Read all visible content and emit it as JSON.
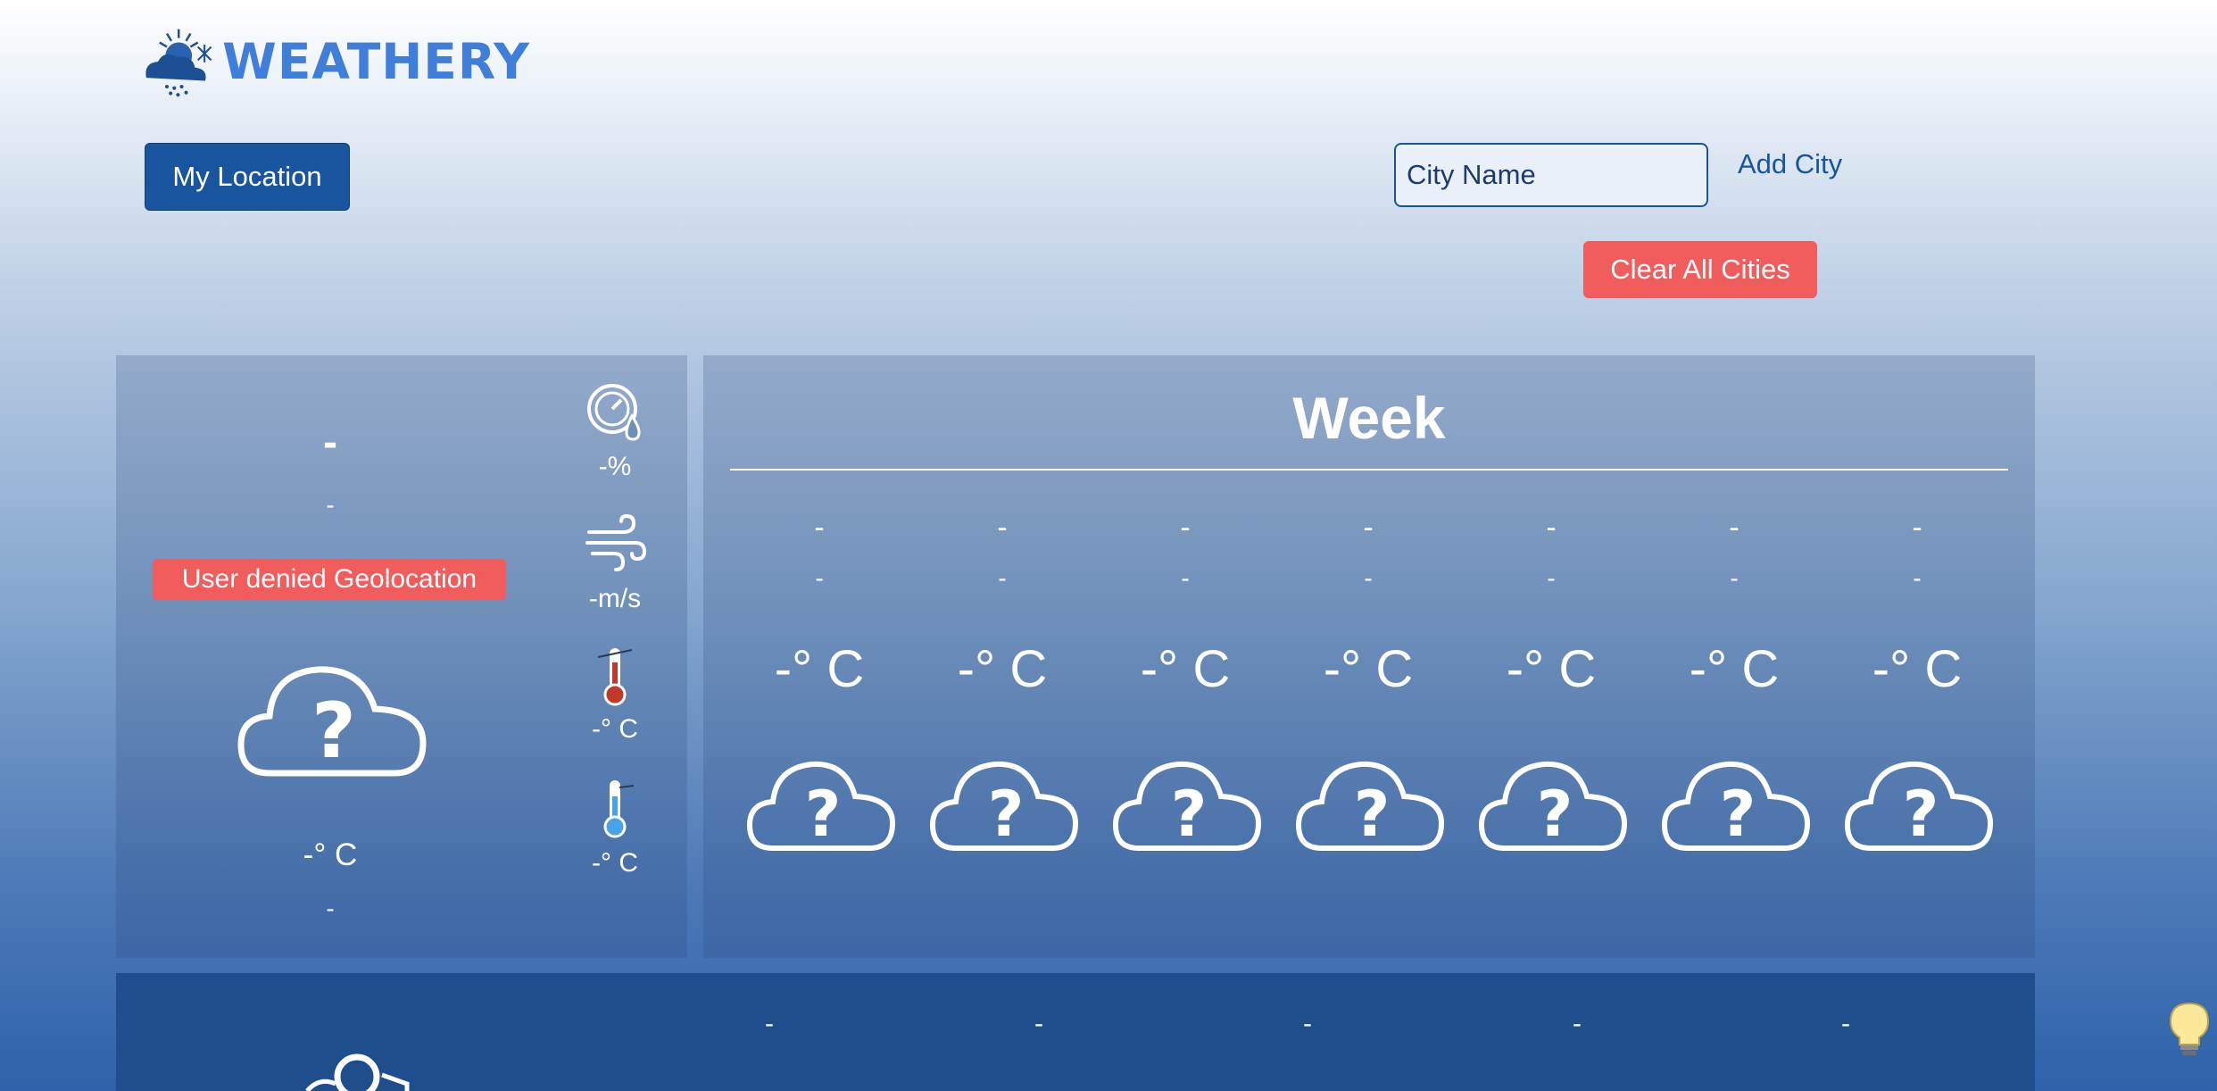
{
  "brand": {
    "name": "WEATHERY"
  },
  "controls": {
    "my_location_label": "My Location",
    "city_placeholder": "City Name",
    "add_city_label": "Add City",
    "clear_all_label": "Clear All Cities"
  },
  "today": {
    "city": "-",
    "date": "-",
    "error": "User denied Geolocation",
    "temperature": "-° C",
    "description": "-",
    "icon": "unknown-weather-icon",
    "metrics": [
      {
        "icon": "humidity-gauge-icon",
        "value": "-%"
      },
      {
        "icon": "wind-icon",
        "value": "-m/s"
      },
      {
        "icon": "thermometer-hot-icon",
        "value": "-° C"
      },
      {
        "icon": "thermometer-cold-icon",
        "value": "-° C"
      }
    ]
  },
  "week": {
    "title": "Week",
    "days": [
      {
        "name": "-",
        "date": "-",
        "temp": "-° C",
        "icon": "unknown-weather-icon"
      },
      {
        "name": "-",
        "date": "-",
        "temp": "-° C",
        "icon": "unknown-weather-icon"
      },
      {
        "name": "-",
        "date": "-",
        "temp": "-° C",
        "icon": "unknown-weather-icon"
      },
      {
        "name": "-",
        "date": "-",
        "temp": "-° C",
        "icon": "unknown-weather-icon"
      },
      {
        "name": "-",
        "date": "-",
        "temp": "-° C",
        "icon": "unknown-weather-icon"
      },
      {
        "name": "-",
        "date": "-",
        "temp": "-° C",
        "icon": "unknown-weather-icon"
      },
      {
        "name": "-",
        "date": "-",
        "temp": "-° C",
        "icon": "unknown-weather-icon"
      }
    ]
  },
  "saved_cities": {
    "items": [
      {
        "label": "-"
      },
      {
        "label": "-"
      },
      {
        "label": "-"
      },
      {
        "label": "-"
      },
      {
        "label": "-"
      }
    ]
  },
  "colors": {
    "primary": "#18559e",
    "brand_text": "#3f7fd9",
    "danger": "#f15c5c",
    "panel_dark": "#1e4f8c"
  }
}
